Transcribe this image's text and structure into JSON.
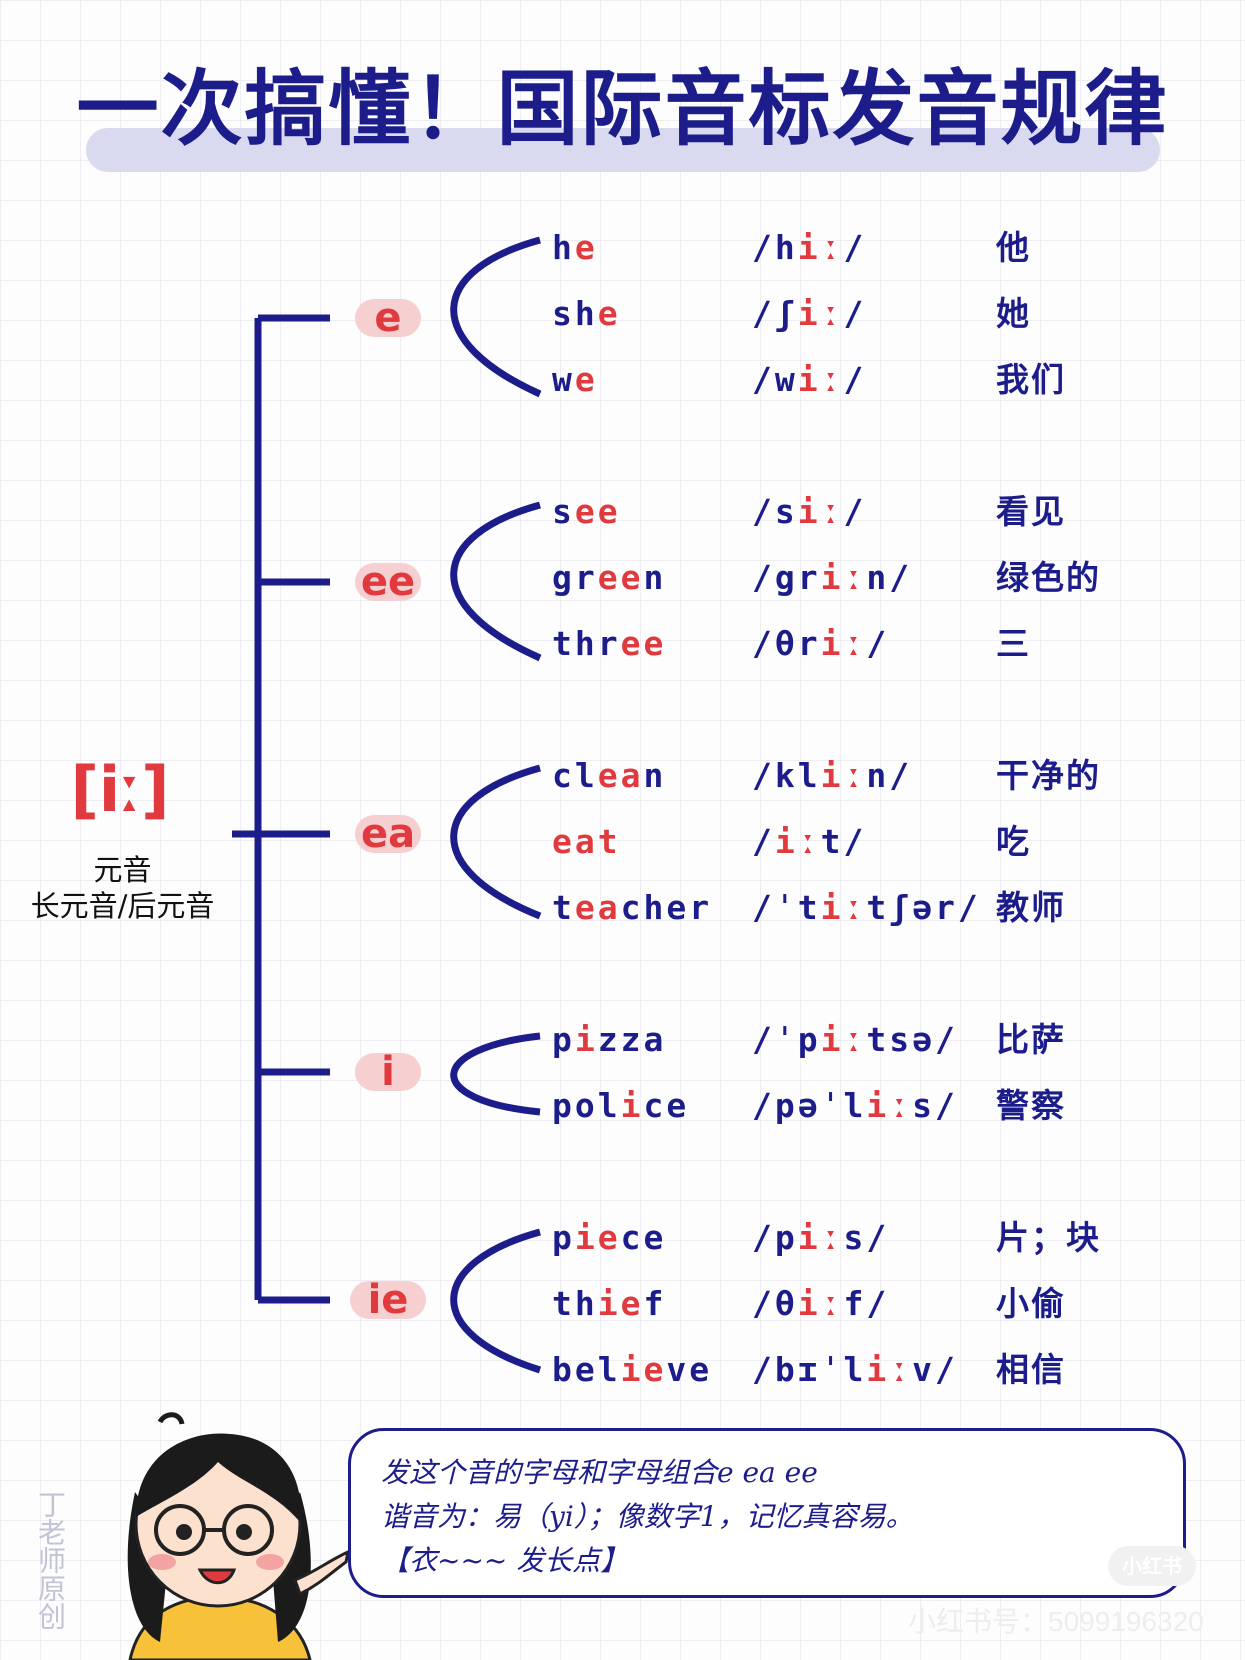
{
  "title": "一次搞懂！国际音标发音规律",
  "root": {
    "ipa": "[iː]",
    "note_line1": "元音",
    "note_line2": "长元音/后元音"
  },
  "groups": [
    {
      "spelling": "e",
      "words": [
        {
          "parts": [
            {
              "t": "h"
            },
            {
              "t": "e",
              "hl": true
            }
          ],
          "ipa": [
            {
              "t": "/h"
            },
            {
              "t": "iː",
              "hl": true
            },
            {
              "t": "/"
            }
          ],
          "meaning": "他"
        },
        {
          "parts": [
            {
              "t": "sh"
            },
            {
              "t": "e",
              "hl": true
            }
          ],
          "ipa": [
            {
              "t": "/ʃ"
            },
            {
              "t": "iː",
              "hl": true
            },
            {
              "t": "/"
            }
          ],
          "meaning": "她"
        },
        {
          "parts": [
            {
              "t": "w"
            },
            {
              "t": "e",
              "hl": true
            }
          ],
          "ipa": [
            {
              "t": "/w"
            },
            {
              "t": "iː",
              "hl": true
            },
            {
              "t": "/"
            }
          ],
          "meaning": "我们"
        }
      ]
    },
    {
      "spelling": "ee",
      "words": [
        {
          "parts": [
            {
              "t": "s"
            },
            {
              "t": "ee",
              "hl": true
            }
          ],
          "ipa": [
            {
              "t": "/s"
            },
            {
              "t": "iː",
              "hl": true
            },
            {
              "t": "/"
            }
          ],
          "meaning": "看见"
        },
        {
          "parts": [
            {
              "t": "gr"
            },
            {
              "t": "ee",
              "hl": true
            },
            {
              "t": "n"
            }
          ],
          "ipa": [
            {
              "t": "/gr"
            },
            {
              "t": "iː",
              "hl": true
            },
            {
              "t": "n/"
            }
          ],
          "meaning": "绿色的"
        },
        {
          "parts": [
            {
              "t": "thr"
            },
            {
              "t": "ee",
              "hl": true
            }
          ],
          "ipa": [
            {
              "t": "/θr"
            },
            {
              "t": "iː",
              "hl": true
            },
            {
              "t": "/"
            }
          ],
          "meaning": "三"
        }
      ]
    },
    {
      "spelling": "ea",
      "words": [
        {
          "parts": [
            {
              "t": "cl"
            },
            {
              "t": "ea",
              "hl": true
            },
            {
              "t": "n"
            }
          ],
          "ipa": [
            {
              "t": "/kl"
            },
            {
              "t": "iː",
              "hl": true
            },
            {
              "t": "n/"
            }
          ],
          "meaning": "干净的"
        },
        {
          "parts": [
            {
              "t": "ea",
              "hl": true
            },
            {
              "t": "t",
              "hl": true
            }
          ],
          "ipa": [
            {
              "t": "/"
            },
            {
              "t": "iː",
              "hl": true
            },
            {
              "t": "t/"
            }
          ],
          "meaning": "吃"
        },
        {
          "parts": [
            {
              "t": "t"
            },
            {
              "t": "ea",
              "hl": true
            },
            {
              "t": "cher"
            }
          ],
          "ipa": [
            {
              "t": "/ˈt"
            },
            {
              "t": "iː",
              "hl": true
            },
            {
              "t": "tʃər/"
            }
          ],
          "meaning": "教师"
        }
      ]
    },
    {
      "spelling": "i",
      "words": [
        {
          "parts": [
            {
              "t": "p"
            },
            {
              "t": "i",
              "hl": true
            },
            {
              "t": "zza"
            }
          ],
          "ipa": [
            {
              "t": "/ˈp"
            },
            {
              "t": "iː",
              "hl": true
            },
            {
              "t": "tsə/"
            }
          ],
          "meaning": "比萨"
        },
        {
          "parts": [
            {
              "t": "pol"
            },
            {
              "t": "i",
              "hl": true
            },
            {
              "t": "ce"
            }
          ],
          "ipa": [
            {
              "t": "/pəˈl"
            },
            {
              "t": "iː",
              "hl": true
            },
            {
              "t": "s/"
            }
          ],
          "meaning": "警察"
        }
      ]
    },
    {
      "spelling": "ie",
      "words": [
        {
          "parts": [
            {
              "t": "p"
            },
            {
              "t": "ie",
              "hl": true
            },
            {
              "t": "ce"
            }
          ],
          "ipa": [
            {
              "t": "/p"
            },
            {
              "t": "iː",
              "hl": true
            },
            {
              "t": "s/"
            }
          ],
          "meaning": "片；块"
        },
        {
          "parts": [
            {
              "t": "th"
            },
            {
              "t": "ie",
              "hl": true
            },
            {
              "t": "f"
            }
          ],
          "ipa": [
            {
              "t": "/θ"
            },
            {
              "t": "iː",
              "hl": true
            },
            {
              "t": "f/"
            }
          ],
          "meaning": "小偷"
        },
        {
          "parts": [
            {
              "t": "bel"
            },
            {
              "t": "ie",
              "hl": true
            },
            {
              "t": "ve"
            }
          ],
          "ipa": [
            {
              "t": "/bɪˈl"
            },
            {
              "t": "iː",
              "hl": true
            },
            {
              "t": "v/"
            }
          ],
          "meaning": "相信"
        }
      ]
    }
  ],
  "speech": {
    "line1": "发这个音的字母和字母组合e  ea  ee",
    "line2": "谐音为：易（yi）；像数字1，记忆真容易。",
    "line3": "【衣~~~ 发长点】"
  },
  "credit": "丁老师原创",
  "watermark": {
    "logo": "小红书",
    "id": "小红书号：5099196320"
  },
  "colors": {
    "navy": "#1c1d8a",
    "red": "#e0393e",
    "pill": "#f6d0d0",
    "title_band": "#d9d9ef"
  }
}
